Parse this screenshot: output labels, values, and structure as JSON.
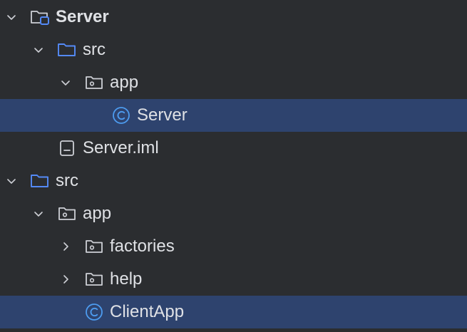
{
  "tree": [
    {
      "label": "Server",
      "level": 0,
      "toggle": "down",
      "icon": "module-folder-icon",
      "bold": true,
      "selected": false
    },
    {
      "label": "src",
      "level": 1,
      "toggle": "down",
      "icon": "source-folder-icon",
      "bold": false,
      "selected": false
    },
    {
      "label": "app",
      "level": 2,
      "toggle": "down",
      "icon": "package-folder-icon",
      "bold": false,
      "selected": false
    },
    {
      "label": "Server",
      "level": 3,
      "toggle": "none",
      "icon": "class-icon",
      "bold": false,
      "selected": true
    },
    {
      "label": "Server.iml",
      "level": 1,
      "toggle": "none",
      "icon": "iml-file-icon",
      "bold": false,
      "selected": false
    },
    {
      "label": "src",
      "level": 0,
      "toggle": "down",
      "icon": "source-folder-icon",
      "bold": false,
      "selected": false
    },
    {
      "label": "app",
      "level": 1,
      "toggle": "down",
      "icon": "package-folder-icon",
      "bold": false,
      "selected": false
    },
    {
      "label": "factories",
      "level": 2,
      "toggle": "right",
      "icon": "package-folder-icon",
      "bold": false,
      "selected": false
    },
    {
      "label": "help",
      "level": 2,
      "toggle": "right",
      "icon": "package-folder-icon",
      "bold": false,
      "selected": false
    },
    {
      "label": "ClientApp",
      "level": 2,
      "toggle": "none",
      "icon": "class-icon",
      "bold": false,
      "selected": true
    }
  ],
  "colors": {
    "background": "#2b2d30",
    "selection": "#2e436e",
    "text": "#dfe1e5",
    "icon_gray": "#ced0d6",
    "icon_blue": "#548af7",
    "class_icon": "#4d9cf0"
  }
}
